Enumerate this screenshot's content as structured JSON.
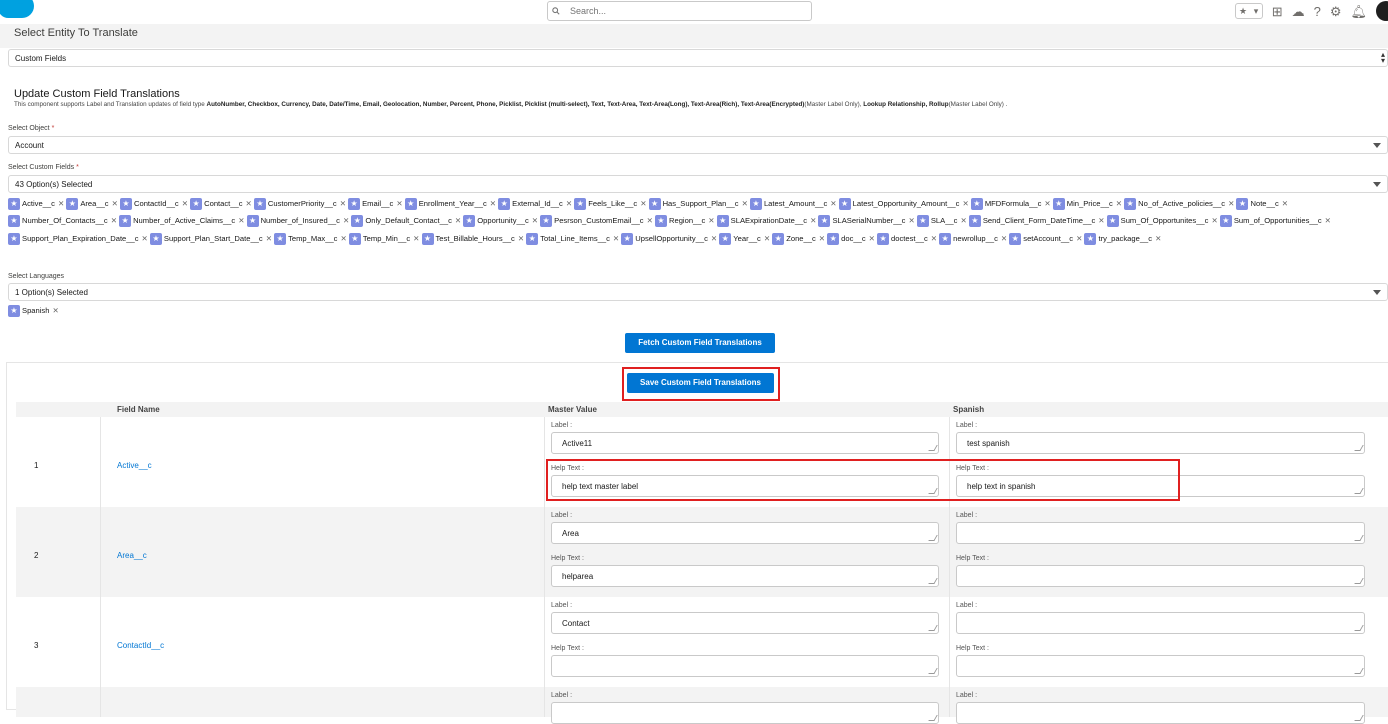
{
  "topbar": {
    "search_placeholder": "Search...",
    "icons": [
      "favorites-star-icon",
      "favorites-dropdown-icon",
      "add-icon",
      "trailhead-icon",
      "help-icon",
      "setup-gear-icon",
      "notifications-bell-icon",
      "user-avatar"
    ]
  },
  "entity": {
    "header": "Select Entity To Translate",
    "selected": "Custom Fields"
  },
  "section": {
    "title": "Update Custom Field Translations",
    "description_parts": [
      {
        "t": "This component supports Label and Translation updates of field type ",
        "b": false
      },
      {
        "t": "AutoNumber, Checkbox, Currency, Date, Date/Time, Email, Geolocation, Number, Percent, Phone, Picklist, Picklist (multi-select), Text, Text-Area, Text-Area(Long), Text-Area(Rich), Text-Area(Encrypted)",
        "b": true
      },
      {
        "t": "(Master Label Only), ",
        "b": false
      },
      {
        "t": "Lookup Relationship, Rollup",
        "b": true
      },
      {
        "t": "(Master Label Only) .",
        "b": false
      }
    ]
  },
  "object_select": {
    "label": "Select Object",
    "required": "*",
    "value": "Account"
  },
  "fields_select": {
    "label": "Select Custom Fields",
    "required": "*",
    "value": "43 Option(s) Selected",
    "pills": [
      "Active__c",
      "Area__c",
      "ContactId__c",
      "Contact__c",
      "CustomerPriority__c",
      "Email__c",
      "Enrollment_Year__c",
      "External_Id__c",
      "Feels_Like__c",
      "Has_Support_Plan__c",
      "Latest_Amount__c",
      "Latest_Opportunity_Amount__c",
      "MFDFormula__c",
      "Min_Price__c",
      "No_of_Active_policies__c",
      "Note__c",
      "Number_Of_Contacts__c",
      "Number_of_Active_Claims__c",
      "Number_of_Insured__c",
      "Only_Default_Contact__c",
      "Opportunity__c",
      "Pesrson_CustomEmail__c",
      "Region__c",
      "SLAExpirationDate__c",
      "SLASerialNumber__c",
      "SLA__c",
      "Send_Client_Form_DateTime__c",
      "Sum_Of_Opportunites__c",
      "Sum_of_Opportunities__c",
      "Support_Plan_Expiration_Date__c",
      "Support_Plan_Start_Date__c",
      "Temp_Max__c",
      "Temp_Min__c",
      "Test_Billable_Hours__c",
      "Total_Line_Items__c",
      "UpsellOpportunity__c",
      "Year__c",
      "Zone__c",
      "doc__c",
      "doctest__c",
      "newrollup__c",
      "setAccount__c",
      "try_package__c"
    ]
  },
  "languages_select": {
    "label": "Select Languages",
    "value": "1 Option(s) Selected",
    "pills": [
      "Spanish"
    ]
  },
  "buttons": {
    "fetch": "Fetch Custom Field Translations",
    "save": "Save Custom Field Translations"
  },
  "table": {
    "headers": {
      "field": "Field Name",
      "master": "Master Value",
      "lang": "Spanish"
    },
    "label_caption": "Label :",
    "help_caption": "Help Text :",
    "rows": [
      {
        "num": "1",
        "field": "Active__c",
        "master_label": "Active11",
        "master_help": "help text master label",
        "lang_label": "test spanish",
        "lang_help": "help text in spanish"
      },
      {
        "num": "2",
        "field": "Area__c",
        "master_label": "Area",
        "master_help": "helparea",
        "lang_label": "",
        "lang_help": ""
      },
      {
        "num": "3",
        "field": "ContactId__c",
        "master_label": "Contact",
        "master_help": "",
        "lang_label": "",
        "lang_help": ""
      },
      {
        "num": "",
        "field": "",
        "master_label": "",
        "master_help": "",
        "lang_label": "",
        "lang_help": ""
      }
    ]
  }
}
